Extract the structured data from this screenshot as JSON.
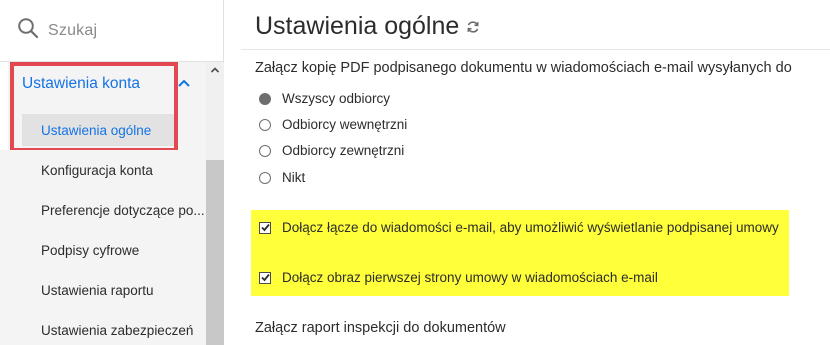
{
  "search": {
    "placeholder": "Szukaj",
    "icon": "search-icon"
  },
  "sidebar": {
    "group": {
      "label": "Ustawienia konta",
      "expanded": true,
      "chevron_icon": "chevron-up-icon"
    },
    "active_item": "Ustawienia ogólne",
    "items": [
      {
        "label": "Konfiguracja konta"
      },
      {
        "label": "Preferencje dotyczące po..."
      },
      {
        "label": "Podpisy cyfrowe"
      },
      {
        "label": "Ustawienia raportu"
      },
      {
        "label": "Ustawienia zabezpieczeń"
      }
    ]
  },
  "main": {
    "title": "Ustawienia ogólne",
    "refresh_icon": "refresh-icon",
    "section1": {
      "title": "Załącz kopię PDF podpisanego dokumentu w wiadomościach e-mail wysyłanych do",
      "options": [
        {
          "label": "Wszyscy odbiorcy",
          "selected": true
        },
        {
          "label": "Odbiorcy wewnętrzni",
          "selected": false
        },
        {
          "label": "Odbiorcy zewnętrzni",
          "selected": false
        },
        {
          "label": "Nikt",
          "selected": false
        }
      ]
    },
    "checkboxes": [
      {
        "label": "Dołącz łącze do wiadomości e-mail, aby umożliwić wyświetlanie podpisanej umowy",
        "checked": true
      },
      {
        "label": "Dołącz obraz pierwszej strony umowy w wiadomościach e-mail",
        "checked": true
      }
    ],
    "section2": {
      "title": "Załącz raport inspekcji do dokumentów"
    }
  },
  "colors": {
    "accent": "#1473e6",
    "highlight_red": "#e34850",
    "highlight_yellow": "#ffff3a"
  }
}
